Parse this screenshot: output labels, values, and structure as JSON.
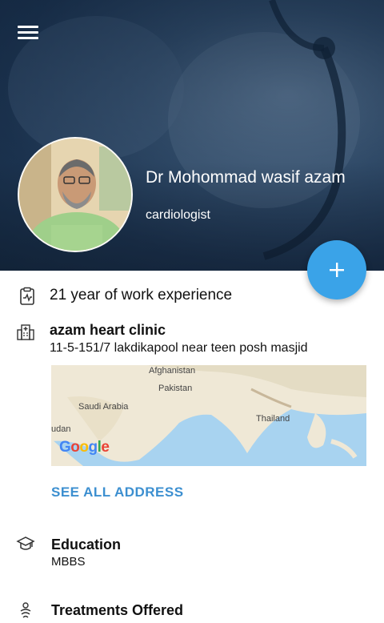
{
  "doctor": {
    "name": "Dr Mohommad wasif azam",
    "specialty": "cardiologist"
  },
  "experience": "21 year of work experience",
  "clinic": {
    "name": "azam heart clinic",
    "address": "11-5-151/7 lakdikapool near teen posh masjid"
  },
  "map": {
    "labels": [
      "Afghanistan",
      "Pakistan",
      "Saudi Arabia",
      "Thailand",
      "udan"
    ],
    "attribution": "Google"
  },
  "see_all_label": "SEE ALL ADDRESS",
  "education": {
    "title": "Education",
    "value": "MBBS"
  },
  "treatments": {
    "title": "Treatments Offered"
  },
  "colors": {
    "accent": "#3aa3e8",
    "link": "#3c8fd0",
    "header": "#1f3550"
  },
  "icons": [
    "menu-icon",
    "add-icon",
    "clipboard-icon",
    "hospital-icon",
    "graduation-cap-icon",
    "treatment-icon"
  ]
}
